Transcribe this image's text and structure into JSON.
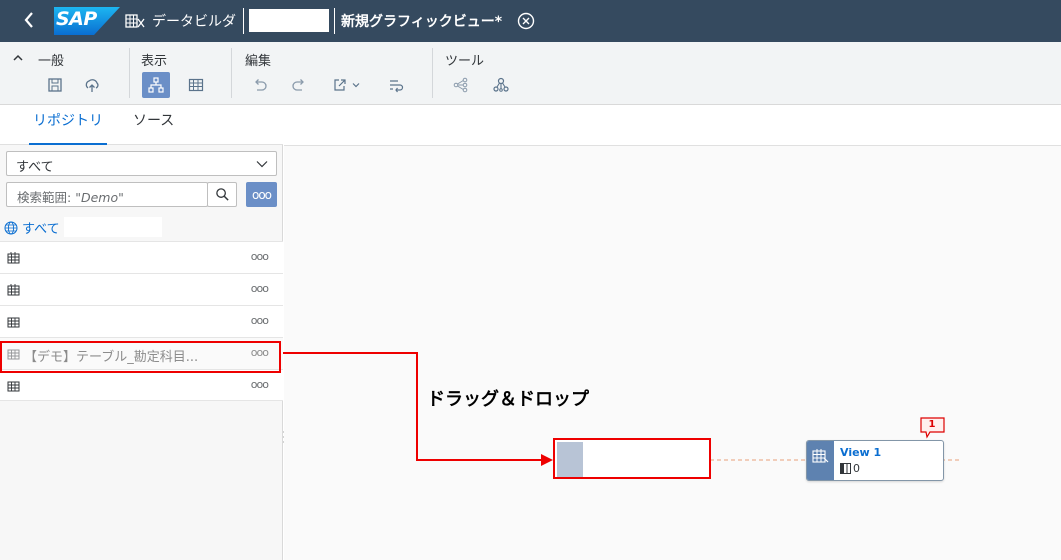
{
  "shell": {
    "logo": "SAP",
    "app_name": "データビルダ",
    "view_title": "新規グラフィックビュー*",
    "icons": {
      "back": "chevron-left-icon",
      "data_builder": "data-builder-icon",
      "close": "close-circle-icon"
    }
  },
  "toolbar": {
    "groups": [
      {
        "title": "一般",
        "buttons": [
          "save-icon",
          "deploy-icon"
        ]
      },
      {
        "title": "表示",
        "buttons": [
          "hierarchy-icon",
          "table-icon"
        ]
      },
      {
        "title": "編集",
        "buttons": [
          "undo-icon",
          "redo-icon",
          "export-icon",
          "wrap-icon"
        ]
      },
      {
        "title": "ツール",
        "buttons": [
          "impact-lineage-icon",
          "network-icon"
        ]
      }
    ],
    "active_button": "hierarchy-icon"
  },
  "left_panel": {
    "tabs": [
      {
        "label": "リポジトリ",
        "active": true
      },
      {
        "label": "ソース",
        "active": false
      }
    ],
    "filter_value": "すべて",
    "search_label": "検索範囲:",
    "search_value": "\"Demo\"",
    "more_label": "ooo",
    "scope_label": "すべて",
    "items": [
      {
        "label": "",
        "icon": "table-icon",
        "more": "ooo",
        "faded": false
      },
      {
        "label": "",
        "icon": "table-icon",
        "more": "ooo",
        "faded": false
      },
      {
        "label": "",
        "icon": "table-icon",
        "more": "ooo",
        "faded": false
      },
      {
        "label": "【デモ】テーブル_勘定科目...",
        "icon": "table-icon",
        "more": "ooo",
        "faded": true
      },
      {
        "label": "",
        "icon": "table-icon",
        "more": "ooo",
        "faded": false
      }
    ]
  },
  "canvas": {
    "annotation": "ドラッグ＆ドロップ",
    "node": {
      "name": "View 1",
      "column_count": "0",
      "badge": "1"
    }
  },
  "colors": {
    "shell": "#354a5f",
    "accent": "#0a6ed1",
    "highlight": "#e00000",
    "node_side": "#5e82b0"
  }
}
